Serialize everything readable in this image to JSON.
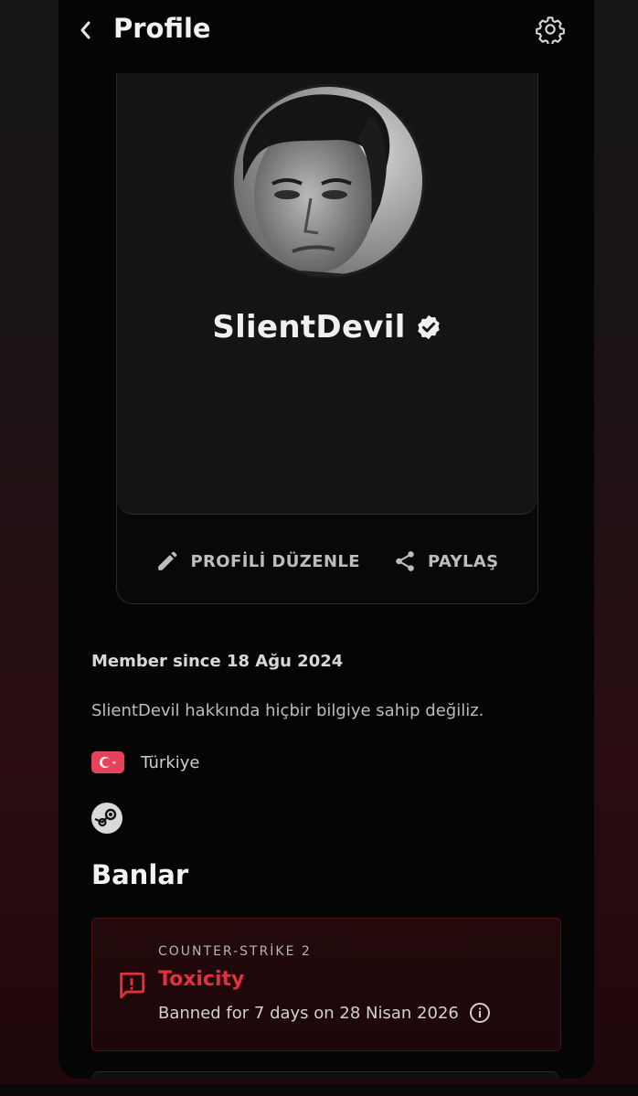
{
  "header": {
    "title": "Profile",
    "back_icon": "chevron-left-icon",
    "settings_icon": "gear-icon"
  },
  "profile": {
    "username": "SlientDevil",
    "verified_icon": "verified-badge-icon",
    "edit_label": "PROFİLİ DÜZENLE",
    "share_label": "PAYLAŞ",
    "member_since": "Member since 18 Ağu 2024",
    "about": "SlientDevil hakkında hiçbir bilgiye sahip değiliz.",
    "country": "Türkiye",
    "country_flag_color": "#e3445a",
    "steam_icon": "steam-icon"
  },
  "bans": {
    "section_title": "Banlar",
    "items": [
      {
        "game": "COUNTER-STRİKE 2",
        "reason": "Toxicity",
        "detail": "Banned for 7 days on 28 Nisan 2026",
        "accent_color": "#e0323c"
      }
    ]
  }
}
